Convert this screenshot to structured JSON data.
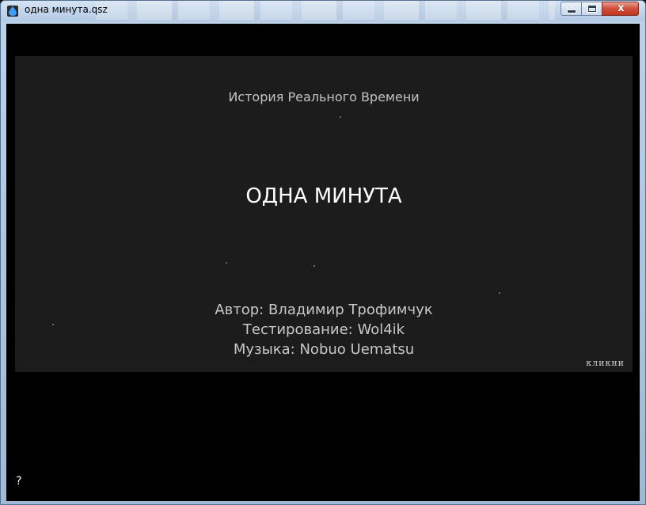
{
  "window": {
    "title": "одна минута.qsz",
    "close_label": "x"
  },
  "game": {
    "subtitle": "История Реального Времени",
    "title": "ОДНА МИНУТА",
    "credits": [
      "Автор: Владимир Трофимчук",
      "Тестирование: Wol4ik",
      "Музыка: Nobuo Uematsu"
    ],
    "click_hint": "кликни"
  },
  "footer": {
    "help_label": "?"
  },
  "colors": {
    "panel_bg": "#1c1c1c",
    "client_bg": "#000000",
    "title_text": "#ffffff",
    "secondary_text": "#c3c3c3"
  }
}
